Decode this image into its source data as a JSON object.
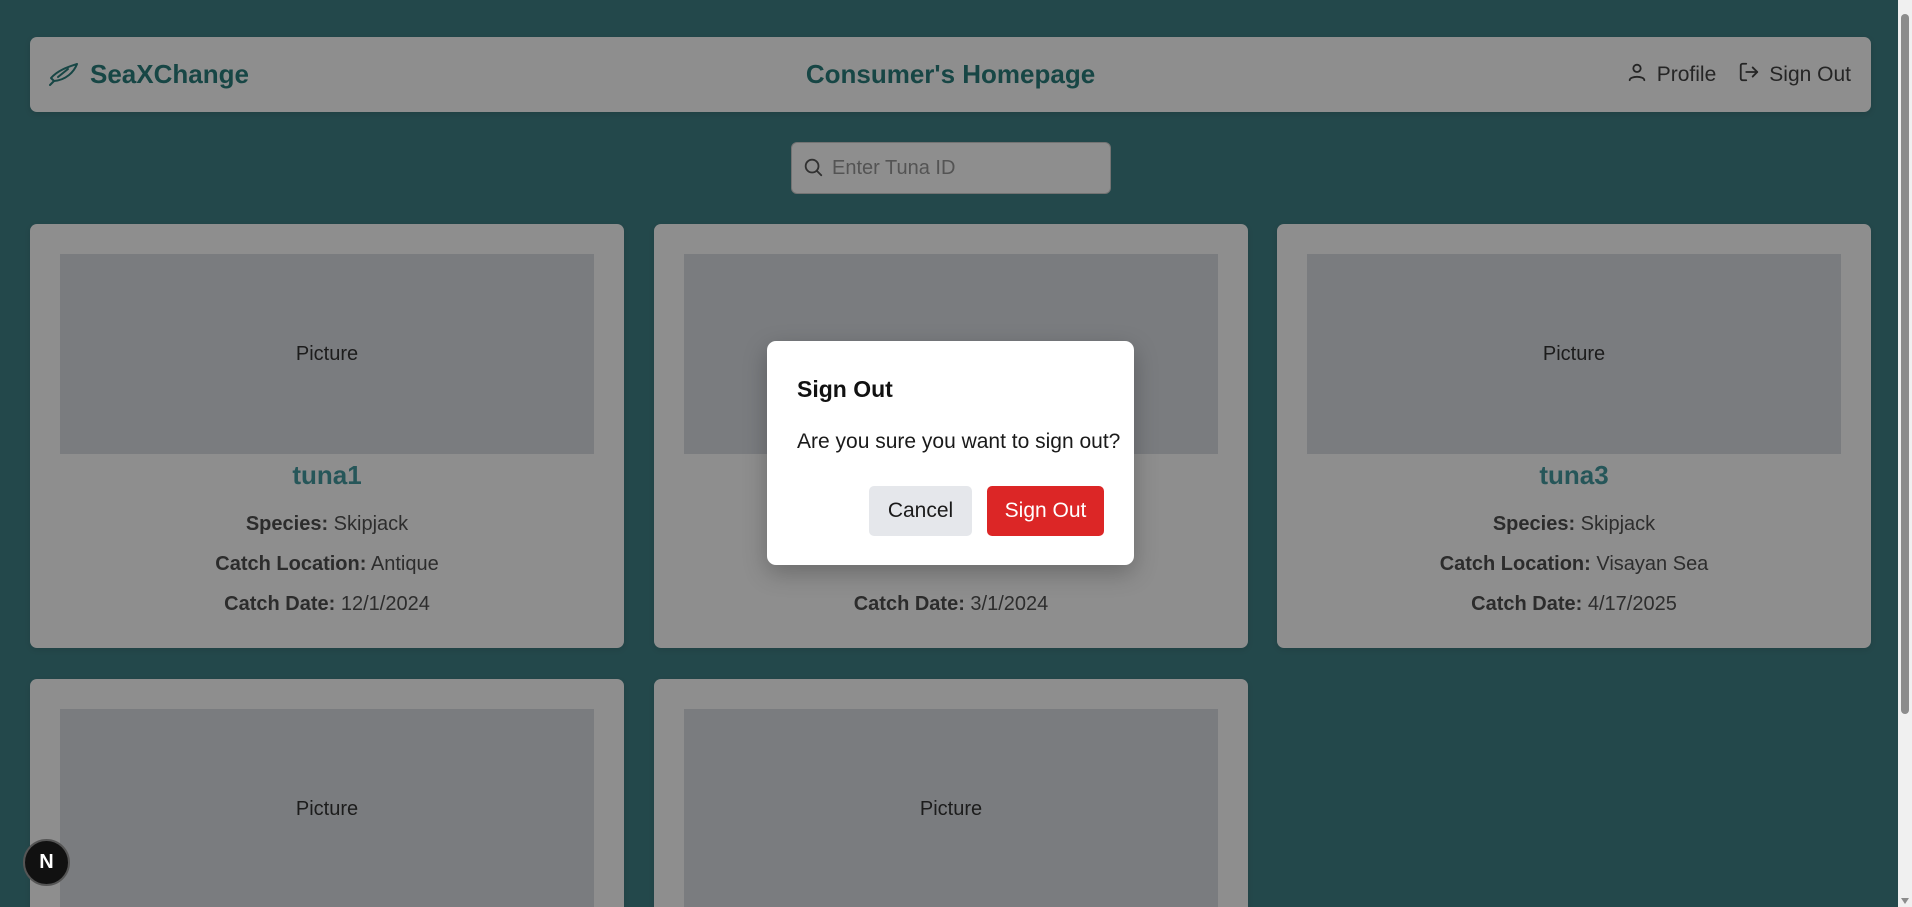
{
  "navbar": {
    "brand": "SeaXChange",
    "title": "Consumer's Homepage",
    "profile_label": "Profile",
    "signout_label": "Sign Out"
  },
  "search": {
    "placeholder": "Enter Tuna ID",
    "value": ""
  },
  "labels": {
    "species": "Species:",
    "location": "Catch Location:",
    "date": "Catch Date:"
  },
  "cards": [
    {
      "picture": "Picture",
      "title": "tuna1",
      "species": "Skipjack",
      "location": "Antique",
      "date": "12/1/2024"
    },
    {
      "picture": "Picture",
      "title": "",
      "species": "",
      "location": "",
      "date": "3/1/2024"
    },
    {
      "picture": "Picture",
      "title": "tuna3",
      "species": "Skipjack",
      "location": "Visayan Sea",
      "date": "4/17/2025"
    },
    {
      "picture": "Picture"
    },
    {
      "picture": "Picture"
    }
  ],
  "dialog": {
    "title": "Sign Out",
    "message": "Are you sure you want to sign out?",
    "cancel_label": "Cancel",
    "confirm_label": "Sign Out"
  },
  "badge": {
    "letter": "N"
  },
  "colors": {
    "background": "#297278",
    "brand": "#116f6c",
    "card_title": "#2f8f95",
    "danger": "#dc2626"
  }
}
